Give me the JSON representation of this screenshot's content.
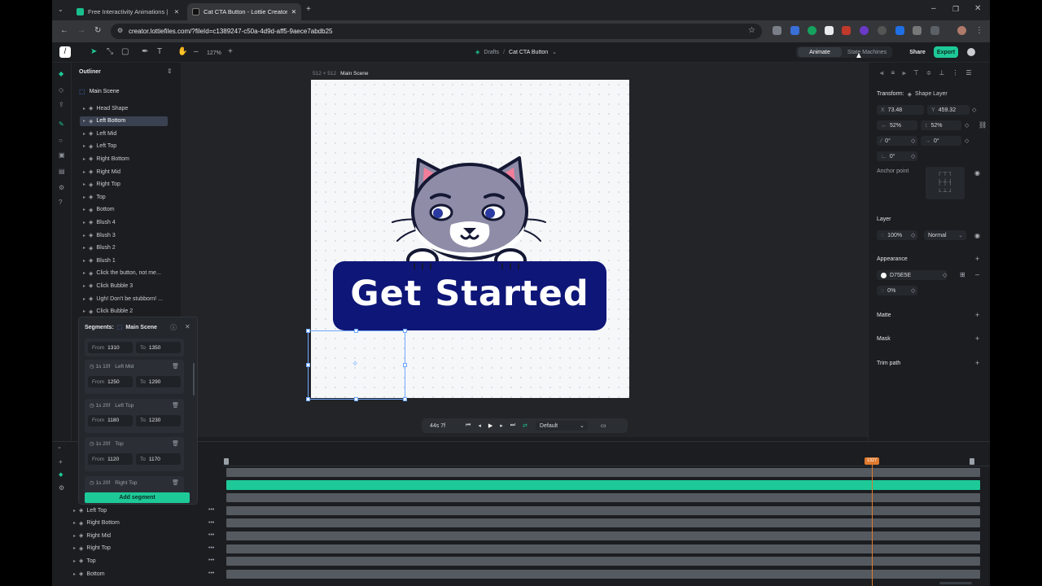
{
  "browser": {
    "tabs": [
      {
        "title": "Free Interactivity Animations | L",
        "active": false,
        "favicon_color": "#19c08e"
      },
      {
        "title": "Cat CTA Button - Lottie Creator",
        "active": true,
        "favicon_color": "#ffffff"
      }
    ],
    "url": "creator.lottiefiles.com/?fileId=c1389247-c50a-4d9d-aff5-9aece7abdb25"
  },
  "toolbar": {
    "zoom": "127%",
    "breadcrumb_root": "Drafts",
    "breadcrumb_file": "Cat CTA Button",
    "mode_animate": "Animate",
    "mode_state_machines": "State Machines",
    "share_label": "Share",
    "export_label": "Export"
  },
  "outliner": {
    "title": "Outliner",
    "scene": "Main Scene",
    "items": [
      "Head Shape",
      "Left Bottom",
      "Left Mid",
      "Left Top",
      "Right Bottom",
      "Right Mid",
      "Right Top",
      "Top",
      "Bottom",
      "Blush 4",
      "Blush 3",
      "Blush 2",
      "Blush 1",
      "Click the button, not me...",
      "Click Bubble 3",
      "Ugh! Don't be stubborn! ...",
      "Click Bubble 2"
    ],
    "selected_index": 1
  },
  "canvas": {
    "size_label": "512 × 512",
    "scene_label": "Main Scene",
    "button_text": "Get Started",
    "button_color": "#0e1677",
    "cat_body_color": "#8f8ca8",
    "ear_inner_color": "#f07e9a"
  },
  "playback": {
    "time": "44s 7f",
    "speed_option": "Default"
  },
  "segments": {
    "title": "Segments:",
    "scene": "Main Scene",
    "first": {
      "from": "1310",
      "to": "1350"
    },
    "cards": [
      {
        "duration": "1s 10f",
        "name": "Left Mid",
        "from": "1250",
        "to": "1290"
      },
      {
        "duration": "1s 20f",
        "name": "Left Top",
        "from": "1180",
        "to": "1230"
      },
      {
        "duration": "1s 20f",
        "name": "Top",
        "from": "1120",
        "to": "1170"
      },
      {
        "duration": "1s 20f",
        "name": "Right Top"
      }
    ],
    "from_label": "From",
    "to_label": "To",
    "add_label": "Add segment"
  },
  "properties": {
    "transform_label": "Transform:",
    "layer_type": "Shape Layer",
    "x_label": "X",
    "x": "73.48",
    "y_label": "Y",
    "y": "459.32",
    "scale_w": "52%",
    "scale_h": "52%",
    "skew": "0°",
    "skew_axis": "0°",
    "rotation": "0°",
    "anchor_label": "Anchor point",
    "layer_label": "Layer",
    "opacity": "100%",
    "blend": "Normal",
    "appearance_label": "Appearance",
    "fill_hex": "D75E5E",
    "fill_opacity": "0%",
    "matte_label": "Matte",
    "mask_label": "Mask",
    "trim_label": "Trim path"
  },
  "timeline": {
    "current_frame": "1327",
    "layers": [
      "Left Top",
      "Right Bottom",
      "Right Mid",
      "Right Top",
      "Top",
      "Bottom"
    ],
    "accent": "#1ec998",
    "playhead_color": "#e07a2e"
  }
}
